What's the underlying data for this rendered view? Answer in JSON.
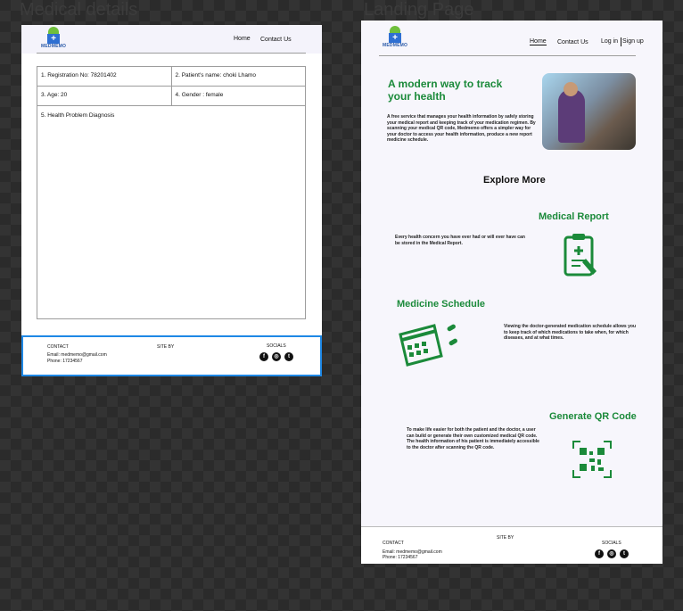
{
  "frames": {
    "left_label": "Medical details",
    "right_label": "Landing Page"
  },
  "brand": {
    "name": "MEDMEMO"
  },
  "left": {
    "nav": {
      "home": "Home",
      "contact": "Contact Us"
    },
    "fields": {
      "registration": "1. Registration No:  78201402",
      "patient_name": "2. Patient's name: choki Lhamo",
      "age": "3. Age: 20",
      "gender": "4. Gender : female",
      "health_problem": "5. Health Problem Diagnosis"
    }
  },
  "right": {
    "nav": {
      "home": "Home",
      "contact": "Contact Us",
      "login": "Log in",
      "signup": "Sign up"
    },
    "hero": {
      "title_line1": "A modern way to track",
      "title_line2": "your health",
      "desc": "A free service that manages your health information by safely storing your medical report and keeping track of your medication regimen. By scanning your medical QR code, Medmemo offers a simpler way for your doctor to access your health information, produce a new report medicine schedule."
    },
    "explore": "Explore More",
    "report": {
      "title": "Medical Report",
      "desc": "Every health concern you have ever had or will ever have can be stored in the Medical Report."
    },
    "schedule": {
      "title": "Medicine Schedule",
      "desc": "Viewing the doctor-generated medication schedule allows you to keep track of which medications to take when, for which diseases, and at what times."
    },
    "qr": {
      "title": "Generate QR Code",
      "desc": "To make life easier for both the patient and the doctor, a user can build or generate their own customized medical QR code. The health information of his patient is immediately accessible to the doctor after scanning the QR code."
    }
  },
  "footer": {
    "contact": "CONTACT",
    "site_by": "SITE BY",
    "socials": "SOCIALS",
    "email": "Email: medmemo@gmail.com",
    "phone": "Phone:  17234567"
  },
  "colors": {
    "brand_green": "#1b8a3a",
    "selection_blue": "#1e88e5",
    "logo_blue": "#2e6fd2"
  },
  "icons": [
    "facebook-icon",
    "instagram-icon",
    "twitter-icon",
    "clipboard-icon",
    "calendar-icon",
    "qr-code-icon"
  ]
}
